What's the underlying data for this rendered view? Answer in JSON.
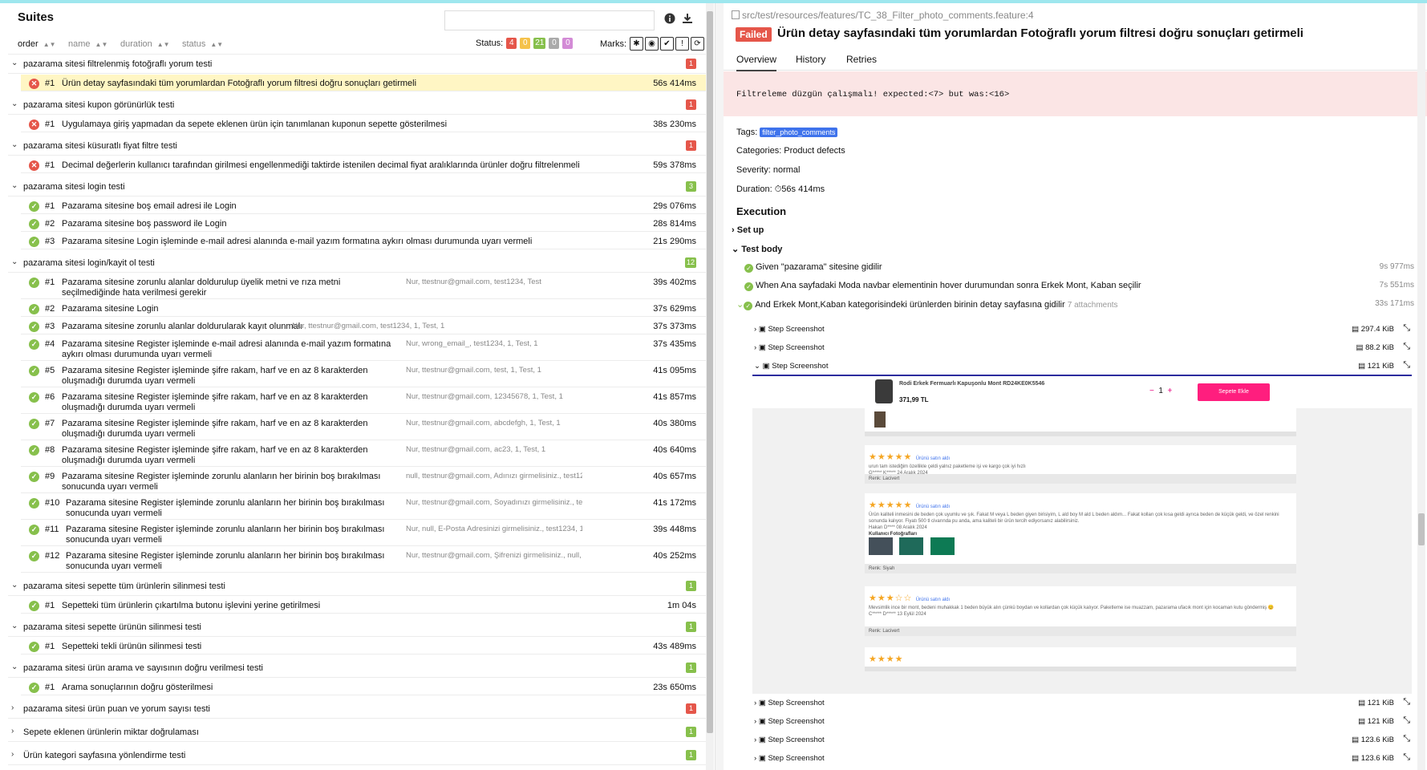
{
  "left": {
    "title": "Suites",
    "search_placeholder": "",
    "sort": [
      "order",
      "name",
      "duration",
      "status"
    ],
    "status_label": "Status:",
    "status_counts": [
      {
        "value": "4",
        "color": "#e5564a"
      },
      {
        "value": "0",
        "color": "#f5c24b"
      },
      {
        "value": "21",
        "color": "#87c04c"
      },
      {
        "value": "0",
        "color": "#aaaaaa"
      },
      {
        "value": "0",
        "color": "#d38bd6"
      }
    ],
    "marks_label": "Marks:",
    "groups": [
      {
        "name": "pazarama sitesi filtrelenmiş fotoğraflı yorum testi",
        "count": "1",
        "color": "#e5564a",
        "items": [
          {
            "num": "#1",
            "title": "Ürün detay sayfasındaki tüm yorumlardan Fotoğraflı yorum filtresi doğru sonuçları getirmeli",
            "params": "",
            "dur": "56s 414ms",
            "status": "fail",
            "selected": true
          }
        ]
      },
      {
        "name": "pazarama sitesi kupon görünürlük testi",
        "count": "1",
        "color": "#e5564a",
        "items": [
          {
            "num": "#1",
            "title": "Uygulamaya giriş yapmadan da sepete eklenen ürün için tanımlanan kuponun sepette gösterilmesi",
            "params": "",
            "dur": "38s 230ms",
            "status": "fail"
          }
        ]
      },
      {
        "name": "pazarama sitesi küsuratlı fiyat filtre testi",
        "count": "1",
        "color": "#e5564a",
        "items": [
          {
            "num": "#1",
            "title": "Decimal değerlerin kullanıcı tarafından girilmesi engellenmediği taktirde istenilen decimal fiyat aralıklarında ürünler doğru filtrelenmeli",
            "params": "",
            "dur": "59s 378ms",
            "status": "fail"
          }
        ]
      },
      {
        "name": "pazarama sitesi login testi",
        "count": "3",
        "color": "#87c04c",
        "items": [
          {
            "num": "#1",
            "title": "Pazarama sitesine boş email adresi ile Login",
            "params": "",
            "dur": "29s 076ms",
            "status": "pass"
          },
          {
            "num": "#2",
            "title": "Pazarama sitesine boş password ile Login",
            "params": "",
            "dur": "28s 814ms",
            "status": "pass"
          },
          {
            "num": "#3",
            "title": "Pazarama sitesine Login işleminde e-mail adresi alanında e-mail yazım formatına aykırı olması durumunda uyarı vermeli",
            "params": "",
            "dur": "21s 290ms",
            "status": "pass"
          }
        ]
      },
      {
        "name": "pazarama sitesi login/kayit ol testi",
        "count": "12",
        "color": "#87c04c",
        "items": [
          {
            "num": "#1",
            "title": "Pazarama sitesine zorunlu alanlar doldurulup üyelik metni ve rıza metni seçilmediğinde hata verilmesi gerekir",
            "params": "Nur, ttestnur@gmail.com, test1234, Test",
            "dur": "39s 402ms",
            "status": "pass"
          },
          {
            "num": "#2",
            "title": "Pazarama sitesine Login",
            "params": "",
            "dur": "37s 629ms",
            "status": "pass"
          },
          {
            "num": "#3",
            "title": "Pazarama sitesine zorunlu alanlar doldurularak kayıt olunmalı",
            "params": "Nur, ttestnur@gmail.com, test1234, 1, Test, 1",
            "dur": "37s 373ms",
            "status": "pass"
          },
          {
            "num": "#4",
            "title": "Pazarama sitesine Register işleminde e-mail adresi alanında e-mail yazım formatına aykırı olması durumunda uyarı vermeli",
            "params": "Nur, wrong_email_, test1234, 1, Test, 1",
            "dur": "37s 435ms",
            "status": "pass"
          },
          {
            "num": "#5",
            "title": "Pazarama sitesine Register işleminde şifre rakam, harf ve en az 8 karakterden oluşmadığı durumda uyarı vermeli",
            "params": "Nur, ttestnur@gmail.com, test, 1, Test, 1",
            "dur": "41s 095ms",
            "status": "pass"
          },
          {
            "num": "#6",
            "title": "Pazarama sitesine Register işleminde şifre rakam, harf ve en az 8 karakterden oluşmadığı durumda uyarı vermeli",
            "params": "Nur, ttestnur@gmail.com, 12345678, 1, Test, 1",
            "dur": "41s 857ms",
            "status": "pass"
          },
          {
            "num": "#7",
            "title": "Pazarama sitesine Register işleminde şifre rakam, harf ve en az 8 karakterden oluşmadığı durumda uyarı vermeli",
            "params": "Nur, ttestnur@gmail.com, abcdefgh, 1, Test, 1",
            "dur": "40s 380ms",
            "status": "pass"
          },
          {
            "num": "#8",
            "title": "Pazarama sitesine Register işleminde şifre rakam, harf ve en az 8 karakterden oluşmadığı durumda uyarı vermeli",
            "params": "Nur, ttestnur@gmail.com, ac23, 1, Test, 1",
            "dur": "40s 640ms",
            "status": "pass"
          },
          {
            "num": "#9",
            "title": "Pazarama sitesine Register işleminde zorunlu alanların her birinin boş bırakılması sonucunda uyarı vermeli",
            "params": "null, ttestnur@gmail.com, Adınızı girmelisiniz., test1234, 1, Te...",
            "dur": "40s 657ms",
            "status": "pass"
          },
          {
            "num": "#10",
            "title": "Pazarama sitesine Register işleminde zorunlu alanların her birinin boş bırakılması sonucunda uyarı vermeli",
            "params": "Nur, ttestnur@gmail.com, Soyadınızı girmelisiniz., test1234, 1, ...",
            "dur": "41s 172ms",
            "status": "pass"
          },
          {
            "num": "#11",
            "title": "Pazarama sitesine Register işleminde zorunlu alanların her birinin boş bırakılması sonucunda uyarı vermeli",
            "params": "Nur, null, E-Posta Adresinizi girmelisiniz., test1234, 1, Test...",
            "dur": "39s 448ms",
            "status": "pass"
          },
          {
            "num": "#12",
            "title": "Pazarama sitesine Register işleminde zorunlu alanların her birinin boş bırakılması sonucunda uyarı vermeli",
            "params": "Nur, ttestnur@gmail.com, Şifrenizi girmelisiniz., null, 1, Tes...",
            "dur": "40s 252ms",
            "status": "pass"
          }
        ]
      },
      {
        "name": "pazarama sitesi sepette tüm ürünlerin silinmesi testi",
        "count": "1",
        "color": "#87c04c",
        "items": [
          {
            "num": "#1",
            "title": "Sepetteki tüm ürünlerin çıkartılma butonu işlevini yerine getirilmesi",
            "params": "",
            "dur": "1m 04s",
            "status": "pass"
          }
        ]
      },
      {
        "name": "pazarama sitesi sepette ürünün silinmesi testi",
        "count": "1",
        "color": "#87c04c",
        "items": [
          {
            "num": "#1",
            "title": "Sepetteki tekli ürünün silinmesi testi",
            "params": "",
            "dur": "43s 489ms",
            "status": "pass"
          }
        ]
      },
      {
        "name": "pazarama sitesi ürün arama ve sayısının doğru verilmesi testi",
        "count": "1",
        "color": "#87c04c",
        "items": [
          {
            "num": "#1",
            "title": "Arama sonuçlarının doğru gösterilmesi",
            "params": "",
            "dur": "23s 650ms",
            "status": "pass"
          }
        ]
      },
      {
        "name": "pazarama sitesi ürün puan ve yorum sayısı testi",
        "count": "1",
        "color": "#e5564a",
        "collapsed": true,
        "items": []
      },
      {
        "name": "Sepete eklenen ürünlerin miktar doğrulaması",
        "count": "1",
        "color": "#87c04c",
        "collapsed": true,
        "items": []
      },
      {
        "name": "Ürün kategori sayfasına yönlendirme testi",
        "count": "1",
        "color": "#87c04c",
        "collapsed": true,
        "items": []
      }
    ]
  },
  "right": {
    "path": "src/test/resources/features/TC_38_Filter_photo_comments.feature:4",
    "status_badge": "Failed",
    "title": "Ürün detay sayfasındaki tüm yorumlardan Fotoğraflı yorum filtresi doğru sonuçları getirmeli",
    "tabs": [
      "Overview",
      "History",
      "Retries"
    ],
    "error": "Filtreleme düzgün çalışmalı! expected:<7> but was:<16>",
    "tags_label": "Tags:",
    "tag": "filter_photo_comments",
    "categories": "Categories: Product defects",
    "severity": "Severity: normal",
    "duration_label": "Duration:",
    "duration": "56s 414ms",
    "execution": "Execution",
    "setup": "Set up",
    "test_body": "Test body",
    "steps": [
      {
        "text": "Given \"pazarama\" sitesine gidilir",
        "dur": "9s 977ms"
      },
      {
        "text": "When Ana sayfadaki Moda navbar elementinin hover durumundan sonra Erkek Mont, Kaban seçilir",
        "dur": "7s 551ms"
      },
      {
        "text": "And Erkek Mont,Kaban kategorisindeki ürünlerden birinin detay sayfasına gidilir",
        "dur": "33s 171ms",
        "extra": "7 attachments"
      }
    ],
    "attachments": [
      {
        "name": "Step Screenshot",
        "size": "297.4 KiB"
      },
      {
        "name": "Step Screenshot",
        "size": "88.2 KiB"
      },
      {
        "name": "Step Screenshot",
        "size": "121 KiB"
      },
      {
        "name": "Step Screenshot",
        "size": "121 KiB"
      },
      {
        "name": "Step Screenshot",
        "size": "121 KiB"
      },
      {
        "name": "Step Screenshot",
        "size": "123.6 KiB"
      },
      {
        "name": "Step Screenshot",
        "size": "123.6 KiB"
      }
    ],
    "preview": {
      "product_name": "Rodi Erkek Fermuarlı Kapuşonlu Mont RD24KE0K5546",
      "price": "371,99 TL",
      "qty": "1",
      "add_to_cart": "Sepete Ekle",
      "reviews": [
        {
          "stars": "★★★★★",
          "text": "urun tam istediğim özellikle çeldi yalnız paketleme işi ve kargo çok iyi hızlı",
          "author": "G***** K*****   24 Aralık 2024",
          "footer": "Renk: Lacivert"
        },
        {
          "stars": "★★★★★",
          "text": "Ürün kaliteli inmesini de beden çok uyumlu ve şık. Fakat M veya L beden giyen birisiyim, L ald boy M ald L beden aldım... Fakat kolları çok kısa geldi ayrıca beden de küçük geldi, ve özel renkini sonunda kalıyor. Fiyatı 500 tl civarında pu anda, ama kaliteli bir ürün tercih ediyorsanız alabilirsiniz.",
          "author": "Hakan D****   08 Aralık 2024",
          "photos_label": "Kullanıcı Fotoğrafları",
          "footer": "Renk: Siyah"
        },
        {
          "stars": "★★★☆☆",
          "text": "Mevsimlik ince bir mont, bedeni muhakkak 1 beden büyük alın çünkü boydan ve kollardan çok küçük kalıyor. Paketleme ise muazzam, pazarama ufacık mont için kocaman kutu göndermiş 😊",
          "author": "C***** D*****   13 Eylül 2024",
          "footer": "Renk: Lacivert"
        }
      ],
      "verified": "Ürünü satın aldı"
    }
  }
}
